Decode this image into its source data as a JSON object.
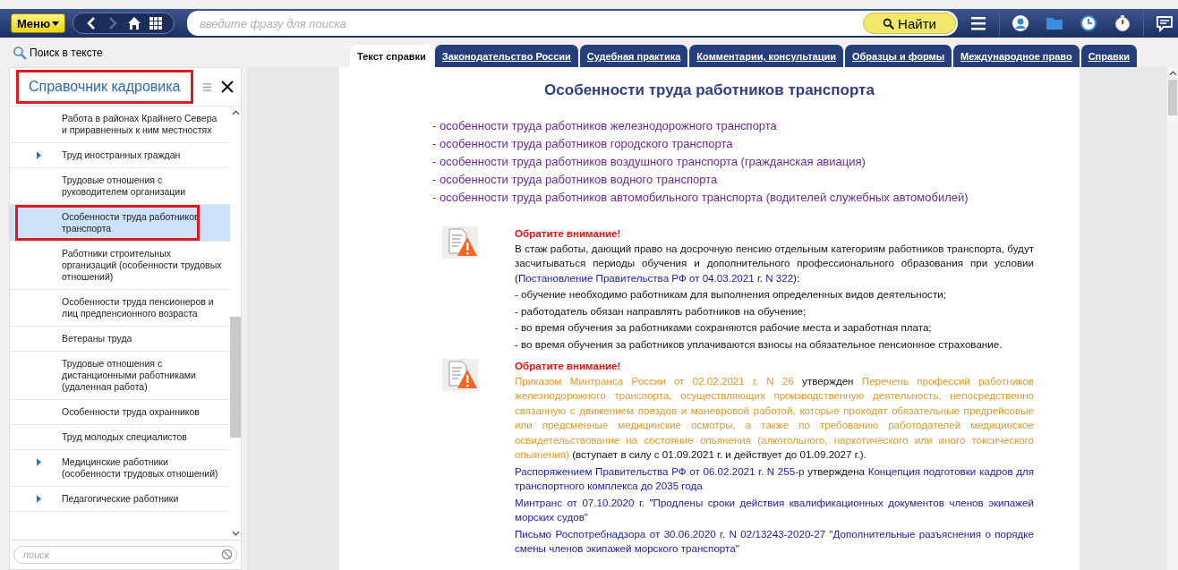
{
  "toolbar": {
    "menu_button": "Меню",
    "search_placeholder": "введите фразу для поиска",
    "find_button": "Найти"
  },
  "text_search": "Поиск в тексте",
  "tabs": [
    {
      "label": "Текст справки",
      "selected": true
    },
    {
      "label": "Законодательство России",
      "selected": false
    },
    {
      "label": "Судебная практика",
      "selected": false
    },
    {
      "label": "Комментарии, консультации",
      "selected": false
    },
    {
      "label": "Образцы и формы",
      "selected": false
    },
    {
      "label": "Международное право",
      "selected": false
    },
    {
      "label": "Справки",
      "selected": false
    }
  ],
  "sidebar": {
    "title": "Справочник кадровика",
    "title_highlighted": true,
    "search_placeholder": "поиск",
    "items": [
      {
        "label": "Работа в районах Крайнего Севера и приравненных к ним местностях",
        "has_children": false,
        "selected": false,
        "highlighted": false
      },
      {
        "label": "Труд иностранных граждан",
        "has_children": true,
        "selected": false,
        "highlighted": false
      },
      {
        "label": "Трудовые отношения с руководителем организации",
        "has_children": false,
        "selected": false,
        "highlighted": false
      },
      {
        "label": "Особенности труда работников транспорта",
        "has_children": false,
        "selected": true,
        "highlighted": true
      },
      {
        "label": "Работники строительных организаций (особенности трудовых отношений)",
        "has_children": false,
        "selected": false,
        "highlighted": false
      },
      {
        "label": "Особенности труда пенсионеров и лиц предпенсионного возраста",
        "has_children": false,
        "selected": false,
        "highlighted": false
      },
      {
        "label": "Ветераны труда",
        "has_children": false,
        "selected": false,
        "highlighted": false
      },
      {
        "label": "Трудовые отношения с дистанционными работниками (удаленная работа)",
        "has_children": false,
        "selected": false,
        "highlighted": false
      },
      {
        "label": "Особенности труда охранников",
        "has_children": false,
        "selected": false,
        "highlighted": false
      },
      {
        "label": "Труд молодых специалистов",
        "has_children": false,
        "selected": false,
        "highlighted": false
      },
      {
        "label": "Медицинские работники (особенности трудовых отношений)",
        "has_children": true,
        "selected": false,
        "highlighted": false
      },
      {
        "label": "Педагогические работники",
        "has_children": true,
        "selected": false,
        "highlighted": false
      }
    ]
  },
  "document": {
    "title": "Особенности труда работников транспорта",
    "links": [
      "- особенности труда работников железнодорожного транспорта",
      "- особенности труда работников городского транспорта",
      "- особенности труда работников воздушного транспорта (гражданская авиация)",
      "- особенности труда работников водного транспорта",
      "- особенности труда работников автомобильного транспорта (водителей служебных автомобилей)"
    ],
    "notices": [
      {
        "title": "Обратите внимание!",
        "paragraphs": [
          [
            {
              "kind": "text",
              "text": "В стаж работы, дающий право на досрочную пенсию отдельным категориям работников транспорта, будут засчитываться периоды обучения и дополнительного профессионального образования при условии ("
            },
            {
              "kind": "link",
              "text": "Постановление Правительства РФ от 04.03.2021 г. N 322"
            },
            {
              "kind": "text",
              "text": "):"
            }
          ],
          [
            {
              "kind": "text",
              "text": "- обучение необходимо работникам для выполнения определенных видов деятельности;"
            }
          ],
          [
            {
              "kind": "text",
              "text": "- работодатель обязан направлять работников на обучение;"
            }
          ],
          [
            {
              "kind": "text",
              "text": "- во время обучения за работниками сохраняются рабочие места и заработная плата;"
            }
          ],
          [
            {
              "kind": "text",
              "text": "- во время обучения за работников уплачиваются взносы на обязательное пенсионное страхование."
            }
          ]
        ]
      },
      {
        "title": "Обратите внимание!",
        "paragraphs": [
          [
            {
              "kind": "doc",
              "text": "Приказом Минтранса России от 02.02.2021 г. N 26"
            },
            {
              "kind": "text",
              "text": " утвержден "
            },
            {
              "kind": "doc",
              "text": "Перечень профессий работников железнодорожного транспорта, осуществляющих производственную деятельность, непосредственно связанную с движением поездов и маневровой работой, которые проходят обязательные предрейсовые или предсменные медицинские осмотры, а также по требованию работодателей медицинское освидетельствование на состояние опьянения (алкогольного, наркотического или иного токсического опьянения)"
            },
            {
              "kind": "text",
              "text": " (вступает в силу с 01.09.2021 г. и действует до 01.09.2027 г.)."
            }
          ],
          [
            {
              "kind": "link",
              "text": "Распоряжением Правительства РФ от 06.02.2021 г. N 255-р"
            },
            {
              "kind": "text",
              "text": " утверждена "
            },
            {
              "kind": "link",
              "text": "Концепция подготовки кадров для транспортного комплекса до 2035 года"
            }
          ],
          [
            {
              "kind": "link",
              "text": "Минтранс от 07.10.2020 г. \"Продлены сроки действия квалификационных документов членов экипажей морских судов\""
            }
          ],
          [
            {
              "kind": "link",
              "text": "Письмо Роспотребнадзора от 30.06.2020 г. N 02/13243-2020-27 \"Дополнительные разъяснения о порядке смены членов экипажей морского транспорта\""
            }
          ]
        ]
      }
    ]
  }
}
